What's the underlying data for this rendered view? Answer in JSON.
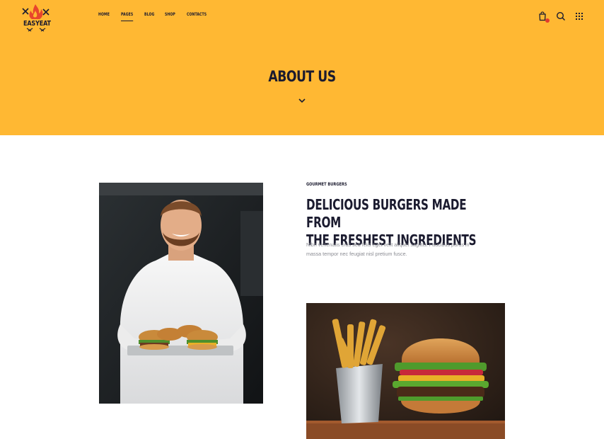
{
  "header": {
    "logo_text": "EASYEAT",
    "nav": [
      {
        "label": "HOME",
        "active": false
      },
      {
        "label": "PAGES",
        "active": true
      },
      {
        "label": "BLOG",
        "active": false
      },
      {
        "label": "SHOP",
        "active": false
      },
      {
        "label": "CONTACTS",
        "active": false
      }
    ],
    "icons": [
      "cart-icon",
      "search-icon",
      "grid-menu-icon"
    ],
    "background_color": "#ffb833"
  },
  "hero": {
    "title": "ABOUT US",
    "scroll_icon": "chevron-down-icon"
  },
  "about": {
    "eyebrow": "GOURMET BURGERS",
    "headline_line1": "DELICIOUS BURGERS MADE FROM",
    "headline_line2": "THE FRESHEST INGREDIENTS",
    "body_line1": "Nibh venenatis cras sed felis eget velit aliquet sagittis. Faucibus purus in",
    "body_line2": "massa tempor nec feugiat nisl pretium fusce."
  },
  "images": {
    "chef": "chef-holding-burgers-photo",
    "burger": "burger-and-fries-photo"
  }
}
